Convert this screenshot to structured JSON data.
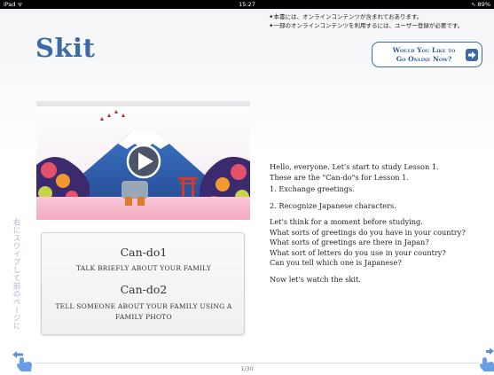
{
  "status_bar": {
    "device": "iPad ᯤ",
    "time": "15:27",
    "battery": "∿ 89%"
  },
  "notice": [
    "✦本書には、オンラインコンテンツが含まれておあります。",
    "✦一部のオンラインコンテンツを利用するには、ユーザー登録が必要です。"
  ],
  "title": "Skit",
  "online_button": {
    "line1": "Would You Like to",
    "line2": "Go Online Now?"
  },
  "cando": {
    "heading1": "Can-do1",
    "desc1": "TALK BRIEFLY ABOUT YOUR FAMILY",
    "heading2": "Can-do2",
    "desc2_line1": "TELL SOMEONE ABOUT YOUR FAMILY USING A",
    "desc2_line2": "FAMILY PHOTO"
  },
  "body_text": {
    "l1": "Hello, everyone. Let's start to study Lesson 1.",
    "l2": "These are the \"Can-do\"s for Lesson 1.",
    "l3": "1.   Exchange greetings.",
    "l4": "2.   Recognize Japanese characters.",
    "l5": "Let's think for a moment before studying.",
    "l6": "What sorts of greetings do you have in your country?",
    "l7": "What sorts of greetings are there in Japan?",
    "l8": "What sort of letters do you use in your country?",
    "l9": "Can you tell which one is Japanese?",
    "l10": "Now let's watch the skit."
  },
  "swipe_hint": "右にスワイプして前のページに",
  "page_number": "1/30",
  "icons": {
    "play": "play-icon",
    "arrow": "arrow-right-icon",
    "hand_left": "swipe-hand-left-icon",
    "hand_right": "swipe-hand-right-icon"
  },
  "colors": {
    "title": "#3b6aa6",
    "accent": "#2c5a96"
  }
}
